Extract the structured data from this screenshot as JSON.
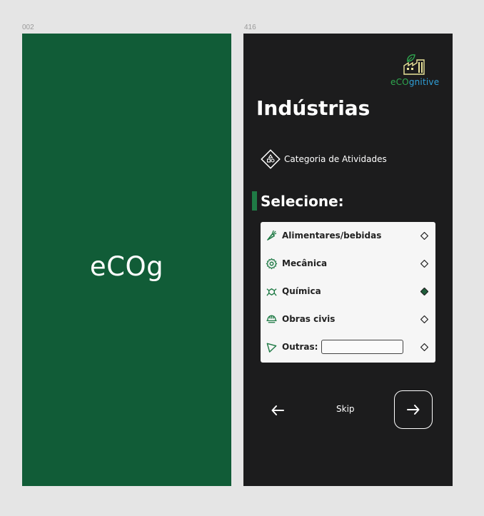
{
  "frames": {
    "splash_label": "002",
    "industries_label": "416"
  },
  "splash": {
    "logo_text": "eCOg",
    "background": "#115c37"
  },
  "brand": {
    "part1": "eCO",
    "part2": "gnitive",
    "icon": "factory-leaf-icon",
    "colors": {
      "eco": "#2fa84f",
      "gnitive": "#2f9fd8"
    }
  },
  "page": {
    "title": "Indústrias",
    "category_label": "Categoria de Atividades",
    "category_icon": "category-shapes-icon",
    "section_title": "Selecione:",
    "accent": "#1f7a45"
  },
  "options": [
    {
      "label": "Alimentares/bebidas",
      "icon": "carrot-icon",
      "selected": false
    },
    {
      "label": "Mecânica",
      "icon": "gear-icon",
      "selected": false
    },
    {
      "label": "Química",
      "icon": "molecule-icon",
      "selected": true
    },
    {
      "label": "Obras civis",
      "icon": "helmet-icon",
      "selected": false
    },
    {
      "label": "Outras:",
      "icon": "triangle-icon",
      "selected": false,
      "input_value": ""
    }
  ],
  "nav": {
    "skip_label": "Skip",
    "back_icon": "arrow-left-icon",
    "next_icon": "arrow-right-icon"
  }
}
